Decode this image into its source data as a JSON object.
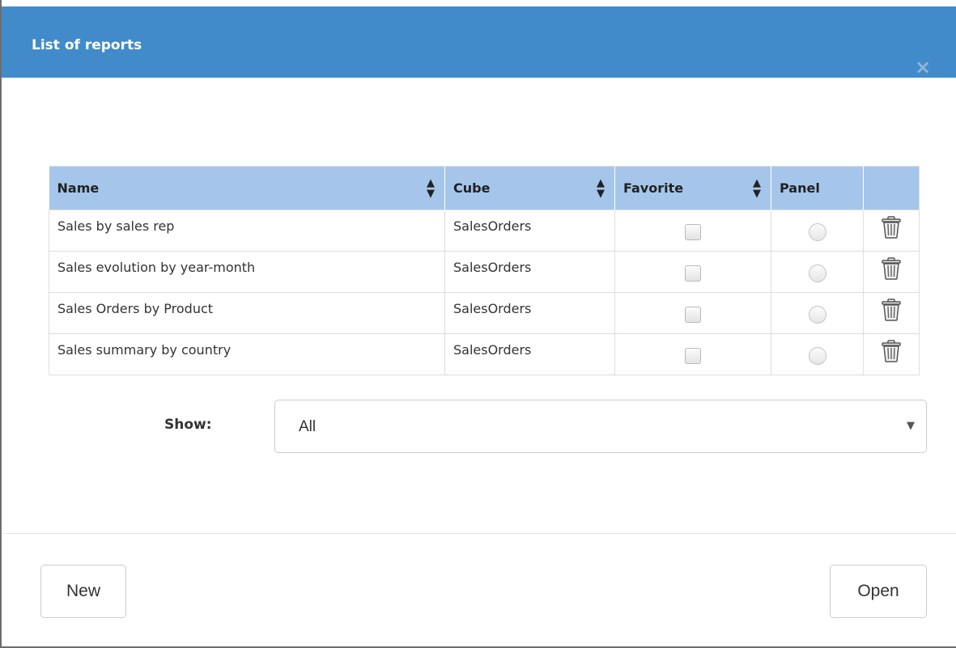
{
  "dialog": {
    "title": "List of reports",
    "close_label": "×"
  },
  "table": {
    "columns": [
      {
        "label": "Name",
        "sortable": true
      },
      {
        "label": "Cube",
        "sortable": true
      },
      {
        "label": "Favorite",
        "sortable": true
      },
      {
        "label": "Panel",
        "sortable": false
      },
      {
        "label": "",
        "sortable": false
      }
    ],
    "sort_glyph": "◆",
    "rows": [
      {
        "name": "Sales by sales rep",
        "cube": "SalesOrders",
        "favorite": false,
        "panel": false
      },
      {
        "name": "Sales evolution by year-month",
        "cube": "SalesOrders",
        "favorite": false,
        "panel": false
      },
      {
        "name": "Sales Orders by Product",
        "cube": "SalesOrders",
        "favorite": false,
        "panel": false
      },
      {
        "name": "Sales summary by country",
        "cube": "SalesOrders",
        "favorite": false,
        "panel": false
      }
    ],
    "row_action_icon": "trash-icon"
  },
  "filter": {
    "label": "Show:",
    "selected": "All",
    "arrow": "▼"
  },
  "footer": {
    "new_label": "New",
    "open_label": "Open"
  },
  "colors": {
    "header_bg": "#428bca",
    "table_header_bg": "#a5c6ea"
  }
}
